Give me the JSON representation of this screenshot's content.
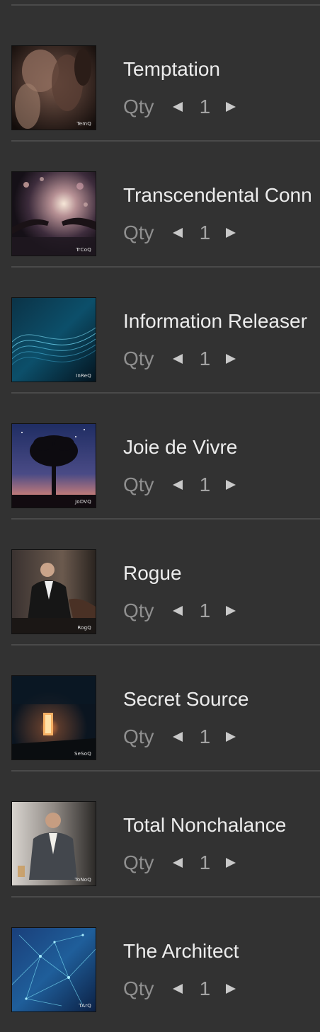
{
  "cart": {
    "qty_label": "Qty",
    "items": [
      {
        "title": "Temptation",
        "code": "TemQ",
        "qty": "1",
        "icon": "couple-embrace-photo"
      },
      {
        "title": "Transcendental Conn",
        "code": "TrCoQ",
        "qty": "1",
        "icon": "hands-light-photo"
      },
      {
        "title": "Information Releaser",
        "code": "InReQ",
        "qty": "1",
        "icon": "digital-wave-photo"
      },
      {
        "title": "Joie de Vivre",
        "code": "JoDVQ",
        "qty": "1",
        "icon": "tree-night-sky-photo"
      },
      {
        "title": "Rogue",
        "code": "RogQ",
        "qty": "1",
        "icon": "man-in-suit-photo"
      },
      {
        "title": "Secret Source",
        "code": "SeSoQ",
        "qty": "1",
        "icon": "glowing-doorway-photo"
      },
      {
        "title": "Total Nonchalance",
        "code": "ToNoQ",
        "qty": "1",
        "icon": "man-seated-photo"
      },
      {
        "title": "The Architect",
        "code": "TArQ",
        "qty": "1",
        "icon": "network-grid-photo"
      }
    ]
  }
}
